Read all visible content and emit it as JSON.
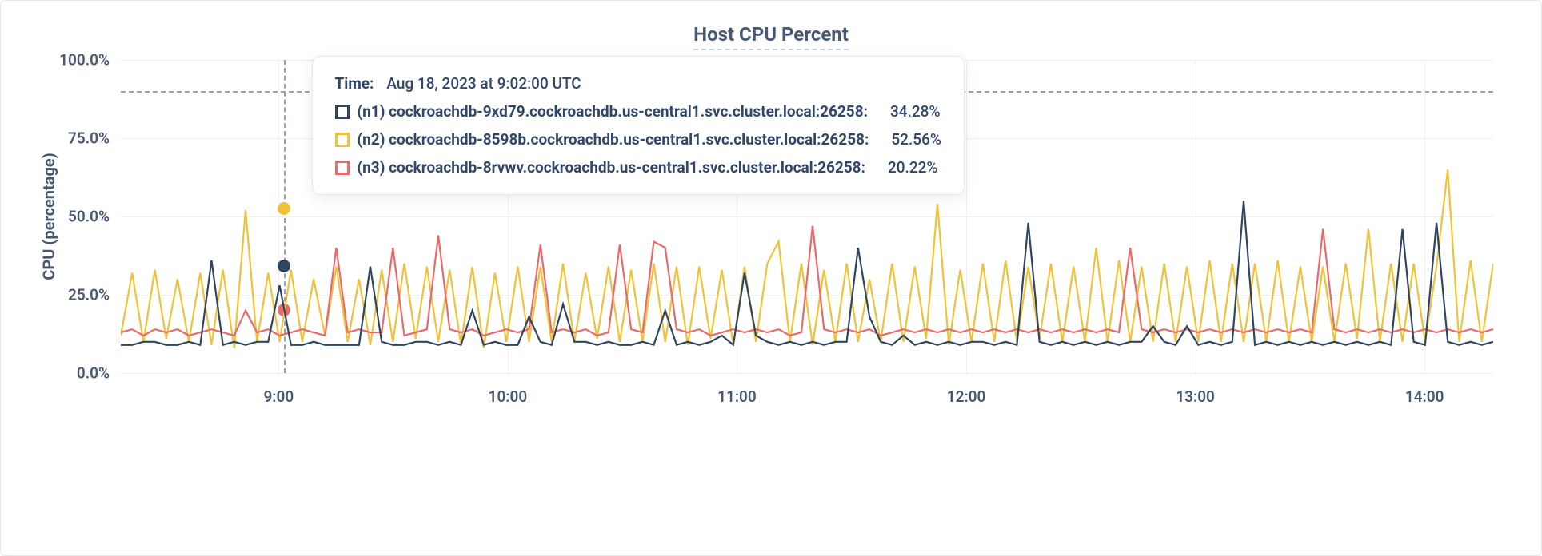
{
  "chart_data": {
    "type": "line",
    "title": "Host CPU Percent",
    "ylabel": "CPU (percentage)",
    "xlabel": "",
    "ylim": [
      0,
      100
    ],
    "y_ticks": [
      "0.0%",
      "25.0%",
      "50.0%",
      "75.0%",
      "100.0%"
    ],
    "x_ticks": [
      "9:00",
      "10:00",
      "11:00",
      "12:00",
      "13:00",
      "14:00"
    ],
    "x_tick_positions_pct": [
      11.5,
      28.2,
      44.9,
      61.6,
      78.3,
      95.0
    ],
    "threshold_pct": 90,
    "cursor_x_pct": 11.9,
    "colors": {
      "n1": "#2f4560",
      "n2": "#f0c23a",
      "n3": "#e96a6a"
    },
    "series": [
      {
        "name": "n1",
        "label": "(n1) cockroachdb-9xd79.cockroachdb.us-central1.svc.cluster.local:26258:",
        "color": "#2f4560",
        "values": [
          9,
          9,
          10,
          10,
          9,
          9,
          10,
          9,
          36,
          9,
          10,
          9,
          10,
          10,
          28,
          9,
          9,
          10,
          9,
          9,
          9,
          9,
          34,
          10,
          9,
          9,
          10,
          10,
          9,
          10,
          9,
          20,
          9,
          10,
          9,
          9,
          18,
          10,
          9,
          22,
          10,
          10,
          9,
          10,
          9,
          9,
          10,
          9,
          20,
          9,
          10,
          9,
          10,
          12,
          9,
          32,
          12,
          10,
          9,
          10,
          9,
          10,
          9,
          10,
          10,
          40,
          18,
          10,
          9,
          12,
          9,
          10,
          9,
          10,
          9,
          10,
          10,
          9,
          10,
          9,
          48,
          10,
          9,
          10,
          9,
          10,
          9,
          10,
          9,
          10,
          10,
          15,
          10,
          9,
          15,
          9,
          10,
          9,
          10,
          55,
          9,
          10,
          9,
          10,
          9,
          10,
          9,
          10,
          9,
          10,
          9,
          10,
          9,
          46,
          10,
          9,
          48,
          10,
          9,
          10,
          9,
          10
        ]
      },
      {
        "name": "n2",
        "label": "(n2) cockroachdb-8598b.cockroachdb.us-central1.svc.cluster.local:26258:",
        "color": "#f0c23a",
        "values": [
          12,
          32,
          10,
          33,
          11,
          30,
          10,
          32,
          9,
          33,
          8,
          52,
          10,
          32,
          10,
          33,
          10,
          30,
          12,
          34,
          10,
          30,
          9,
          33,
          10,
          35,
          11,
          34,
          10,
          33,
          9,
          34,
          8,
          32,
          10,
          34,
          10,
          34,
          10,
          35,
          10,
          32,
          11,
          34,
          10,
          33,
          10,
          35,
          10,
          34,
          9,
          34,
          11,
          33,
          9,
          34,
          10,
          35,
          42,
          10,
          35,
          9,
          33,
          10,
          35,
          10,
          30,
          10,
          35,
          10,
          34,
          11,
          54,
          9,
          33,
          10,
          35,
          10,
          36,
          10,
          34,
          11,
          35,
          10,
          34,
          10,
          40,
          10,
          36,
          10,
          34,
          10,
          35,
          10,
          34,
          10,
          36,
          10,
          35,
          10,
          35,
          10,
          36,
          10,
          34,
          10,
          34,
          10,
          35,
          11,
          46,
          10,
          35,
          10,
          35,
          10,
          34,
          65,
          10,
          36,
          10,
          35
        ]
      },
      {
        "name": "n3",
        "label": "(n3) cockroachdb-8rvwv.cockroachdb.us-central1.svc.cluster.local:26258:",
        "color": "#e96a6a",
        "values": [
          13,
          14,
          12,
          14,
          13,
          14,
          12,
          13,
          14,
          13,
          12,
          20,
          13,
          14,
          12,
          13,
          14,
          13,
          12,
          40,
          13,
          14,
          13,
          13,
          40,
          12,
          13,
          14,
          44,
          14,
          13,
          14,
          12,
          13,
          14,
          13,
          14,
          41,
          13,
          14,
          13,
          14,
          12,
          13,
          41,
          14,
          13,
          42,
          40,
          14,
          13,
          14,
          12,
          13,
          14,
          13,
          14,
          13,
          14,
          12,
          13,
          47,
          14,
          13,
          14,
          13,
          14,
          12,
          13,
          14,
          13,
          14,
          13,
          14,
          13,
          14,
          13,
          14,
          13,
          14,
          13,
          14,
          13,
          14,
          13,
          14,
          13,
          14,
          13,
          40,
          14,
          13,
          14,
          13,
          14,
          13,
          14,
          13,
          14,
          13,
          14,
          13,
          14,
          13,
          14,
          13,
          46,
          14,
          13,
          14,
          13,
          14,
          13,
          14,
          13,
          14,
          13,
          14,
          13,
          14,
          13,
          14
        ]
      }
    ],
    "tooltip": {
      "time_label": "Time:",
      "time_value": "Aug 18, 2023 at 9:02:00 UTC",
      "rows": [
        {
          "swatch": "#2f4560",
          "label": "(n1) cockroachdb-9xd79.cockroachdb.us-central1.svc.cluster.local:26258:",
          "value": "34.28%"
        },
        {
          "swatch": "#f0c23a",
          "label": "(n2) cockroachdb-8598b.cockroachdb.us-central1.svc.cluster.local:26258:",
          "value": "52.56%"
        },
        {
          "swatch": "#e96a6a",
          "label": "(n3) cockroachdb-8rvwv.cockroachdb.us-central1.svc.cluster.local:26258:",
          "value": "20.22%"
        }
      ]
    }
  }
}
